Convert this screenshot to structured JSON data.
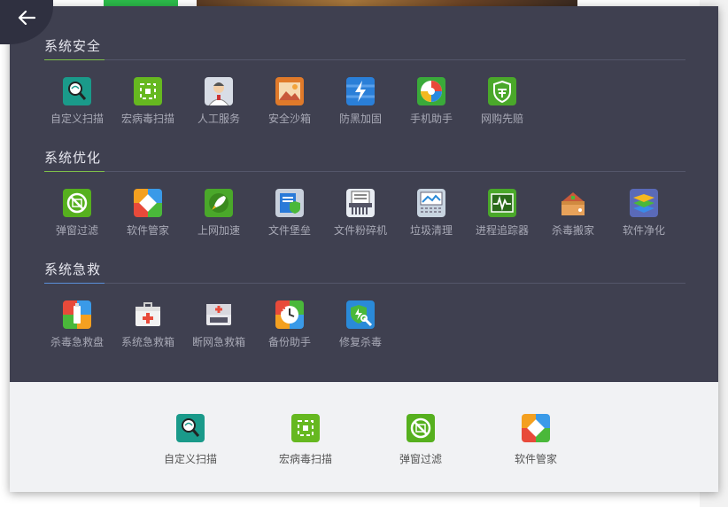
{
  "sections": [
    {
      "title": "系统安全",
      "accent": "#7fc04a",
      "items": [
        {
          "label": "自定义扫描",
          "icon": "magnifier-icon"
        },
        {
          "label": "宏病毒扫描",
          "icon": "macro-scan-icon"
        },
        {
          "label": "人工服务",
          "icon": "support-agent-icon"
        },
        {
          "label": "安全沙箱",
          "icon": "sandbox-icon"
        },
        {
          "label": "防黑加固",
          "icon": "shield-lightning-icon"
        },
        {
          "label": "手机助手",
          "icon": "phone-assistant-icon"
        },
        {
          "label": "网购先赔",
          "icon": "shopping-shield-icon"
        }
      ]
    },
    {
      "title": "系统优化",
      "accent": "#7fc04a",
      "items": [
        {
          "label": "弹窗过滤",
          "icon": "popup-filter-icon"
        },
        {
          "label": "软件管家",
          "icon": "software-manager-icon"
        },
        {
          "label": "上网加速",
          "icon": "rocket-icon"
        },
        {
          "label": "文件堡垒",
          "icon": "file-fortress-icon"
        },
        {
          "label": "文件粉碎机",
          "icon": "file-shredder-icon"
        },
        {
          "label": "垃圾清理",
          "icon": "junk-cleanup-icon"
        },
        {
          "label": "进程追踪器",
          "icon": "process-tracker-icon"
        },
        {
          "label": "杀毒搬家",
          "icon": "antivirus-move-icon"
        },
        {
          "label": "软件净化",
          "icon": "software-purify-icon"
        }
      ]
    },
    {
      "title": "系统急救",
      "accent": "#5a8fd8",
      "items": [
        {
          "label": "杀毒急救盘",
          "icon": "rescue-usb-icon"
        },
        {
          "label": "系统急救箱",
          "icon": "first-aid-kit-icon"
        },
        {
          "label": "断网急救箱",
          "icon": "offline-aid-kit-icon"
        },
        {
          "label": "备份助手",
          "icon": "backup-icon"
        },
        {
          "label": "修复杀毒",
          "icon": "repair-shield-icon"
        }
      ]
    }
  ],
  "quick_tools": [
    {
      "label": "自定义扫描",
      "icon": "magnifier-icon"
    },
    {
      "label": "宏病毒扫描",
      "icon": "macro-scan-icon"
    },
    {
      "label": "弹窗过滤",
      "icon": "popup-filter-icon"
    },
    {
      "label": "软件管家",
      "icon": "software-manager-icon"
    }
  ]
}
